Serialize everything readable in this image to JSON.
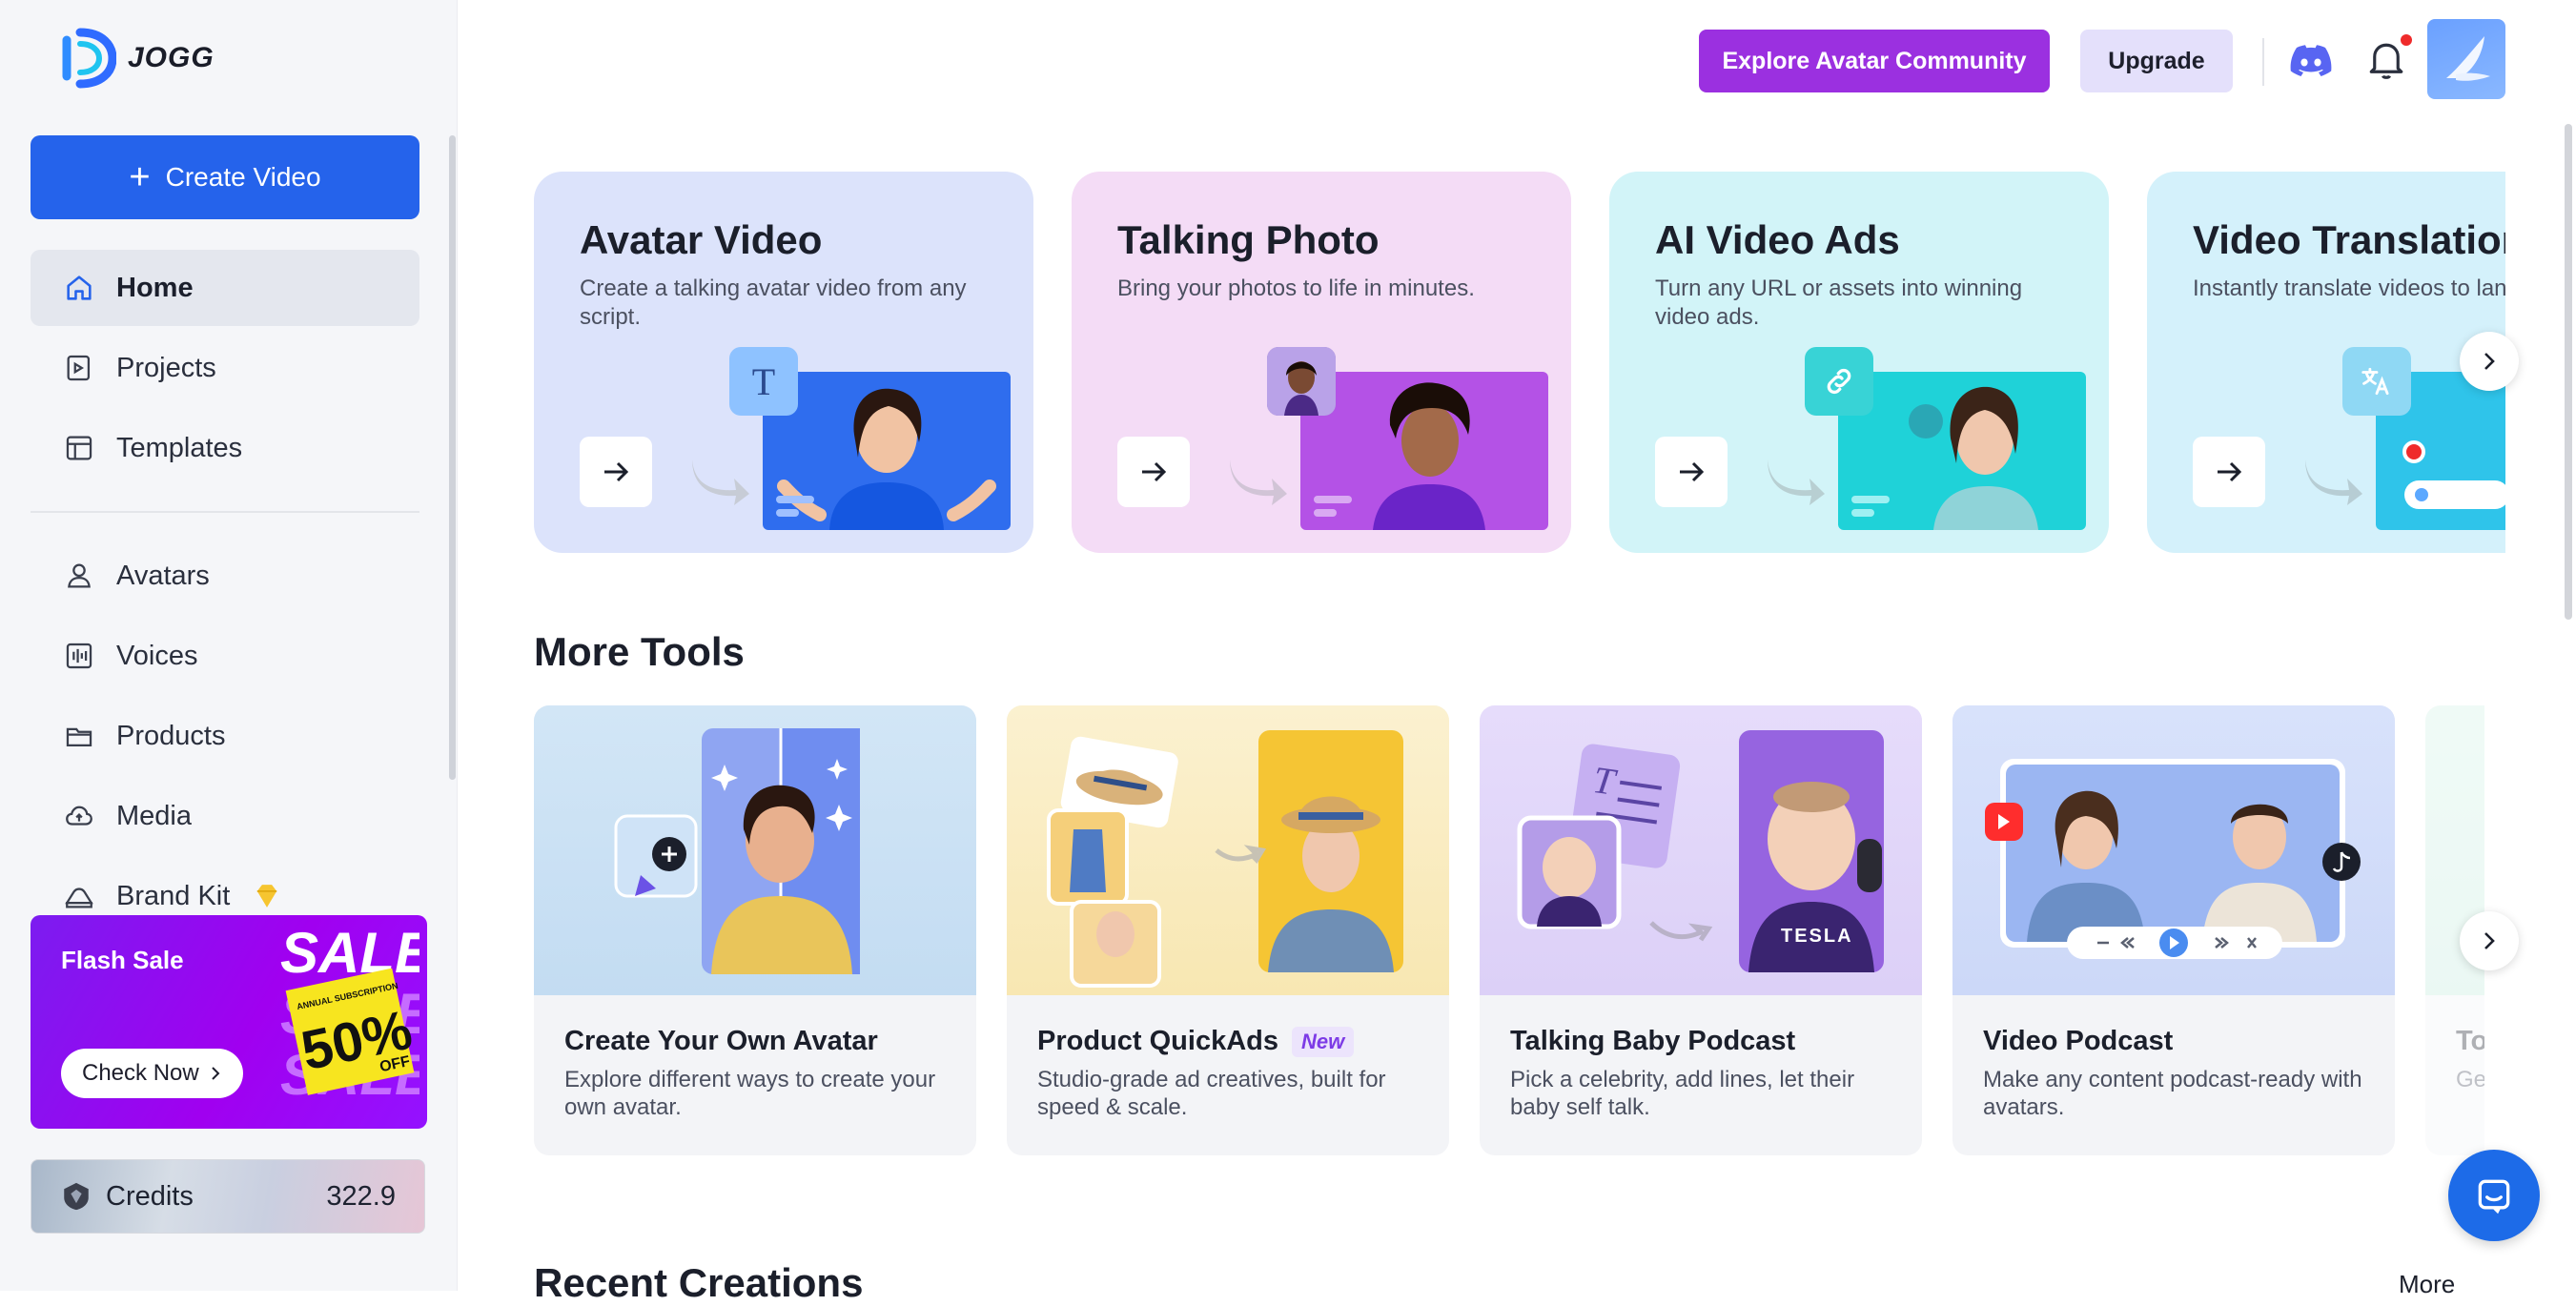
{
  "brand": {
    "name": "JOGG"
  },
  "sidebar": {
    "create_label": "Create Video",
    "items": [
      {
        "label": "Home",
        "icon": "home-icon",
        "active": true
      },
      {
        "label": "Projects",
        "icon": "projects-icon"
      },
      {
        "label": "Templates",
        "icon": "templates-icon"
      },
      {
        "label": "Avatars",
        "icon": "avatar-person-icon"
      },
      {
        "label": "Voices",
        "icon": "voice-wave-icon"
      },
      {
        "label": "Products",
        "icon": "products-box-icon"
      },
      {
        "label": "Media",
        "icon": "media-cloud-icon"
      },
      {
        "label": "Brand Kit",
        "icon": "brand-kit-icon",
        "badge": "diamond-icon"
      }
    ],
    "flash_sale": {
      "title": "Flash Sale",
      "button": "Check Now",
      "art_text_big": "SALE",
      "art_text_small": "ANNUAL SUBSCRIPTION",
      "art_percent": "50%",
      "art_off": "OFF"
    },
    "credits": {
      "label": "Credits",
      "value": "322.9"
    }
  },
  "topbar": {
    "explore_label": "Explore Avatar Community",
    "upgrade_label": "Upgrade"
  },
  "features": [
    {
      "title": "Avatar Video",
      "desc": "Create a talking avatar video from any script.",
      "bg": "#dce3fb",
      "chip": "T"
    },
    {
      "title": "Talking Photo",
      "desc": "Bring your photos to life in minutes.",
      "bg": "#f4dcf6",
      "chip": ""
    },
    {
      "title": "AI Video Ads",
      "desc": "Turn any URL or assets into winning video ads.",
      "bg": "#d2f4f8",
      "chip": ""
    },
    {
      "title": "Video Translation",
      "desc": "Instantly translate videos to languages.",
      "bg": "#d4f1fb",
      "chip": ""
    }
  ],
  "more_tools": {
    "title": "More Tools",
    "cards": [
      {
        "title": "Create Your Own Avatar",
        "desc": "Explore different ways to create your own avatar.",
        "badge": ""
      },
      {
        "title": "Product QuickAds",
        "desc": "Studio-grade ad creatives, built for speed & scale.",
        "badge": "New"
      },
      {
        "title": "Talking Baby Podcast",
        "desc": "Pick a celebrity, add lines, let their baby self talk.",
        "badge": ""
      },
      {
        "title": "Video Podcast",
        "desc": "Make any content podcast-ready with avatars.",
        "badge": ""
      },
      {
        "title": "To",
        "desc": "Ge",
        "badge": ""
      }
    ]
  },
  "recent": {
    "title": "Recent Creations",
    "more_label": "More"
  },
  "art_text": {
    "tesla": "TESLA"
  }
}
